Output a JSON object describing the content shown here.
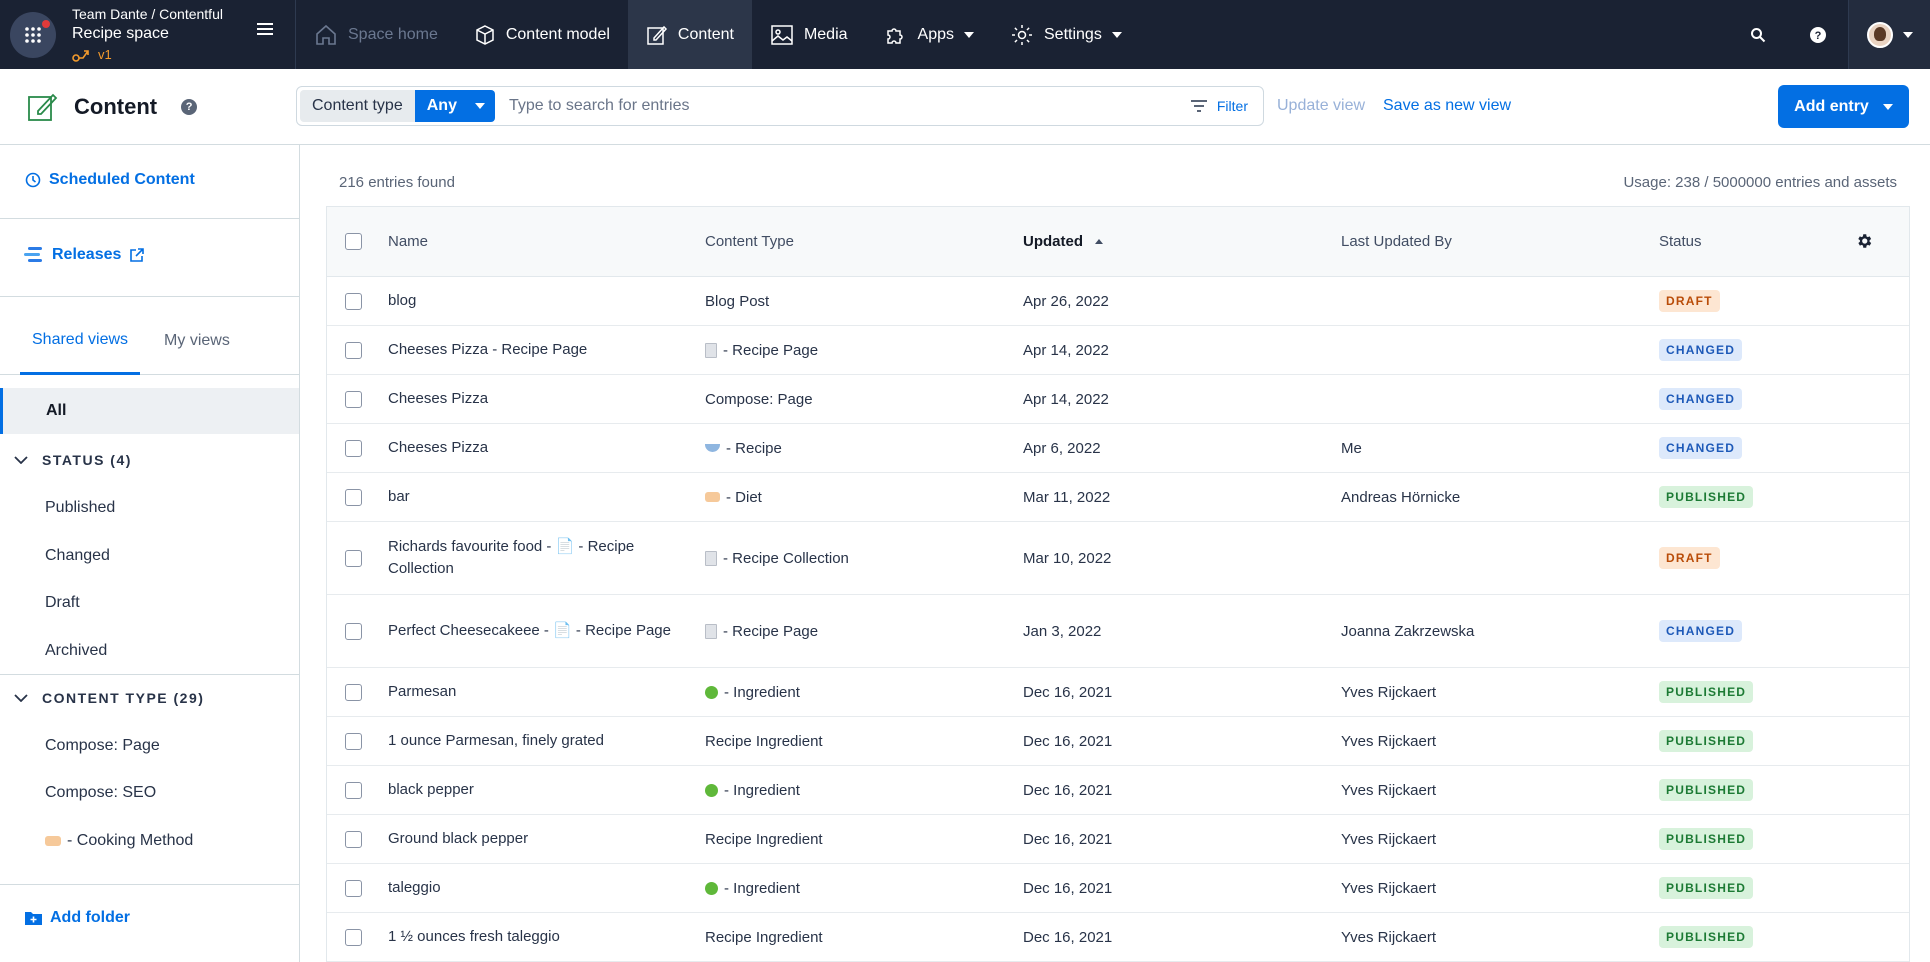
{
  "topnav": {
    "team": "Team Dante / Contentful",
    "space": "Recipe space",
    "environment": "v1",
    "items": [
      {
        "label": "Space home",
        "icon": "home-icon",
        "state": "disabled"
      },
      {
        "label": "Content model",
        "icon": "cube-icon",
        "state": "normal"
      },
      {
        "label": "Content",
        "icon": "pen-square-icon",
        "state": "active"
      },
      {
        "label": "Media",
        "icon": "image-icon",
        "state": "normal"
      },
      {
        "label": "Apps",
        "icon": "puzzle-icon",
        "state": "normal",
        "dropdown": true
      },
      {
        "label": "Settings",
        "icon": "gear-icon",
        "state": "normal",
        "dropdown": true
      }
    ]
  },
  "header": {
    "title": "Content",
    "content_type_label": "Content type",
    "content_type_value": "Any",
    "search_placeholder": "Type to search for entries",
    "filter_label": "Filter",
    "update_view": "Update view",
    "save_view": "Save as new view",
    "add_entry": "Add entry"
  },
  "sidebar": {
    "scheduled": "Scheduled Content",
    "releases": "Releases",
    "tabs": [
      "Shared views",
      "My views"
    ],
    "all": "All",
    "status_group": "STATUS (4)",
    "status_items": [
      "Published",
      "Changed",
      "Draft",
      "Archived"
    ],
    "type_group": "CONTENT TYPE (29)",
    "type_items": [
      "Compose: Page",
      "Compose: SEO",
      "- Cooking Method"
    ],
    "add_folder": "Add folder"
  },
  "main": {
    "entries_found": "216 entries found",
    "usage": "Usage: 238 / 5000000 entries and assets",
    "columns": [
      "Name",
      "Content Type",
      "Updated",
      "Last Updated By",
      "Status"
    ],
    "rows": [
      {
        "name": "blog",
        "type": "Blog Post",
        "type_icon": "",
        "updated": "Apr 26, 2022",
        "by": "",
        "status": "DRAFT"
      },
      {
        "name": "Cheeses Pizza - Recipe Page",
        "type": "- Recipe Page",
        "type_icon": "doc",
        "updated": "Apr 14, 2022",
        "by": "",
        "status": "CHANGED"
      },
      {
        "name": "Cheeses Pizza",
        "type": "Compose: Page",
        "type_icon": "",
        "updated": "Apr 14, 2022",
        "by": "",
        "status": "CHANGED"
      },
      {
        "name": "Cheeses Pizza",
        "type": "- Recipe",
        "type_icon": "bowl",
        "updated": "Apr 6, 2022",
        "by": "Me",
        "status": "CHANGED"
      },
      {
        "name": "bar",
        "type": "- Diet",
        "type_icon": "tag",
        "updated": "Mar 11, 2022",
        "by": "Andreas Hörnicke",
        "status": "PUBLISHED"
      },
      {
        "name": "Richards favourite food - 📄 - Recipe Collection",
        "type": "- Recipe Collection",
        "type_icon": "doc",
        "updated": "Mar 10, 2022",
        "by": "",
        "status": "DRAFT"
      },
      {
        "name": "Perfect Cheesecakeee - 📄 - Recipe Page",
        "type": "- Recipe Page",
        "type_icon": "doc",
        "updated": "Jan 3, 2022",
        "by": "Joanna Zakrzewska",
        "status": "CHANGED"
      },
      {
        "name": "Parmesan",
        "type": "- Ingredient",
        "type_icon": "apple",
        "updated": "Dec 16, 2021",
        "by": "Yves Rijckaert",
        "status": "PUBLISHED"
      },
      {
        "name": "1 ounce Parmesan, finely grated",
        "type": "Recipe Ingredient",
        "type_icon": "",
        "updated": "Dec 16, 2021",
        "by": "Yves Rijckaert",
        "status": "PUBLISHED"
      },
      {
        "name": "black pepper",
        "type": "- Ingredient",
        "type_icon": "apple",
        "updated": "Dec 16, 2021",
        "by": "Yves Rijckaert",
        "status": "PUBLISHED"
      },
      {
        "name": "Ground black pepper",
        "type": "Recipe Ingredient",
        "type_icon": "",
        "updated": "Dec 16, 2021",
        "by": "Yves Rijckaert",
        "status": "PUBLISHED"
      },
      {
        "name": "taleggio",
        "type": "- Ingredient",
        "type_icon": "apple",
        "updated": "Dec 16, 2021",
        "by": "Yves Rijckaert",
        "status": "PUBLISHED"
      },
      {
        "name": "1 ½ ounces fresh taleggio",
        "type": "Recipe Ingredient",
        "type_icon": "",
        "updated": "Dec 16, 2021",
        "by": "Yves Rijckaert",
        "status": "PUBLISHED"
      }
    ]
  },
  "colors": {
    "nav_bg": "#1a2233",
    "accent": "#036fe3",
    "draft": "#b94c08",
    "changed": "#1d59b8",
    "published": "#1c7a34"
  }
}
